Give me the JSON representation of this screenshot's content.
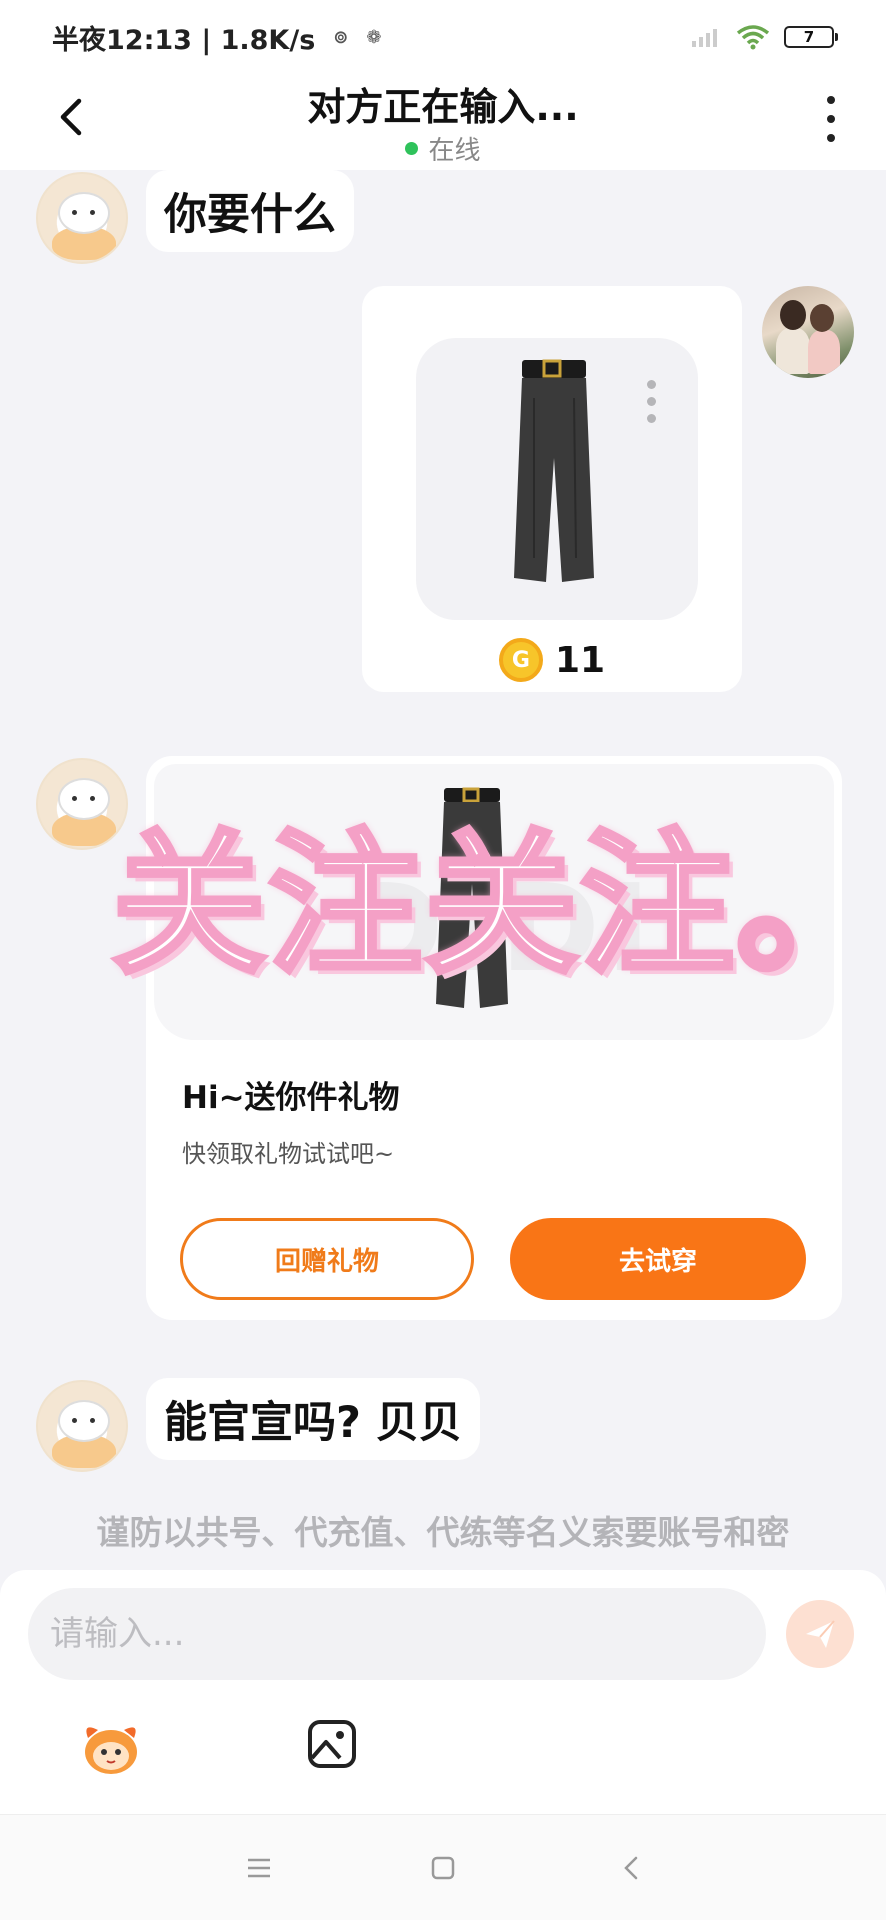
{
  "status_bar": {
    "time_and_speed": "半夜12:13 | 1.8K/s",
    "battery_level": "7"
  },
  "header": {
    "title": "对方正在输入...",
    "status": "在线",
    "status_color": "#2fc25b"
  },
  "messages": {
    "msg1": {
      "sender": "other",
      "text": "你要什么"
    },
    "item_card": {
      "sender": "self",
      "price": "11",
      "coin_icon": "G"
    },
    "gift_card": {
      "sender": "other",
      "title": "Hi~送你件礼物",
      "subtitle": "快领取礼物试试吧~",
      "return_gift_label": "回赠礼物",
      "try_on_label": "去试穿"
    },
    "msg3": {
      "sender": "other",
      "text": "能官宣吗? 贝贝"
    }
  },
  "overlay_text": "关注关注。",
  "notice": "谨防以共号、代充值、代练等名义索要账号和密",
  "input": {
    "placeholder": "请输入..."
  },
  "colors": {
    "accent": "#f97516",
    "background": "#f3f3f7",
    "overlay_pink": "#f4a0c6"
  },
  "icons": [
    "back-icon",
    "more-icon",
    "send-icon",
    "emoji-icon",
    "image-icon",
    "menu-icon",
    "home-icon",
    "nav-back-icon"
  ]
}
